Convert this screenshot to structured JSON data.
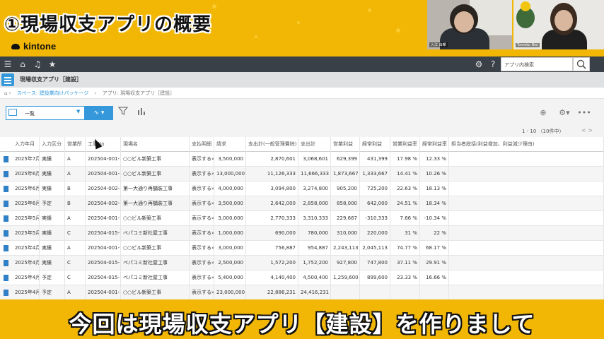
{
  "banner": {
    "title": "①現場収支アプリの概要",
    "logo": "kintone"
  },
  "video": {
    "participant1": "入江 由暉",
    "participant2": "Tomoko Nisi",
    "subtitle": "今回は現場収支アプリ【建設】を作りまして"
  },
  "header": {
    "icons": [
      "menu-icon",
      "home-icon",
      "bell-icon",
      "star-icon",
      "gear-icon",
      "help-icon"
    ],
    "search_placeholder": "アプリ内検索"
  },
  "app": {
    "name": "現場収支アプリ［建設］",
    "breadcrumb": [
      "スペース: 建設業向けパッケージ",
      "アプリ: 現場収支アプリ［建設］"
    ]
  },
  "toolbar": {
    "view_name": "一覧",
    "record_count": "1 - 10 （10件中）",
    "pager": "<   >"
  },
  "table": {
    "columns": [
      "入力年月",
      "入力区分",
      "営業所",
      "工事No",
      "現場名",
      "支払明細",
      "請求",
      "支出計(一般管理費除)",
      "支出計",
      "営業利益",
      "経常利益",
      "営業利益率",
      "経常利益率",
      "担当者総括(利益増加、利益減少理由)"
    ],
    "rows": [
      [
        "2025年7月",
        "実績",
        "A",
        "202504-001-1",
        "○○ビル新築工事",
        "表示する»",
        "3,500,000",
        "2,870,601",
        "3,068,601",
        "629,399",
        "431,399",
        "17.98 %",
        "12.33 %",
        ""
      ],
      [
        "2025年6月",
        "実績",
        "A",
        "202504-001-1",
        "○○ビル新築工事",
        "表示する»",
        "13,000,000",
        "11,126,333",
        "11,666,333",
        "1,873,667",
        "1,333,667",
        "14.41 %",
        "10.26 %",
        ""
      ],
      [
        "2025年6月",
        "実績",
        "B",
        "202504-002-1",
        "第一大通り再舗装工事",
        "表示する»",
        "4,000,000",
        "3,094,800",
        "3,274,800",
        "905,200",
        "725,200",
        "22.63 %",
        "18.13 %",
        ""
      ],
      [
        "2025年6月",
        "予定",
        "B",
        "202504-002-1",
        "第一大通り再舗装工事",
        "表示する»",
        "3,500,000",
        "2,642,000",
        "2,858,000",
        "858,000",
        "642,000",
        "24.51 %",
        "18.34 %",
        ""
      ],
      [
        "2025年5月",
        "実績",
        "A",
        "202504-001-1",
        "○○ビル新築工事",
        "表示する»",
        "3,000,000",
        "2,770,333",
        "3,310,333",
        "229,667",
        "-310,333",
        "7.66 %",
        "-10.34 %",
        ""
      ],
      [
        "2025年5月",
        "実績",
        "C",
        "202504-015-1",
        "ペパコミ新社屋工事",
        "表示する»",
        "1,000,000",
        "690,000",
        "780,000",
        "310,000",
        "220,000",
        "31 %",
        "22 %",
        ""
      ],
      [
        "2025年4月",
        "実績",
        "A",
        "202504-001-1",
        "○○ビル新築工事",
        "表示する»",
        "3,000,000",
        "756,887",
        "954,887",
        "2,243,113",
        "2,045,113",
        "74.77 %",
        "68.17 %",
        ""
      ],
      [
        "2025年4月",
        "実績",
        "C",
        "202504-015-1",
        "ペパコミ新社屋工事",
        "表示する»",
        "2,500,000",
        "1,572,200",
        "1,752,200",
        "927,800",
        "747,800",
        "37.11 %",
        "29.91 %",
        ""
      ],
      [
        "2025年4月",
        "予定",
        "C",
        "202504-015-1",
        "ペパコミ新社屋工事",
        "表示する»",
        "5,400,000",
        "4,140,400",
        "4,500,400",
        "1,259,600",
        "899,600",
        "23.33 %",
        "16.66 %",
        ""
      ],
      [
        "2025年4月",
        "予定",
        "A",
        "202504-001-1",
        "○○ビル新築工事",
        "表示する»",
        "23,000,000",
        "22,886,231",
        "24,416,231",
        "",
        "",
        "",
        "",
        ""
      ]
    ]
  },
  "colors": {
    "banner": "#f2b705",
    "accent": "#3498db",
    "header": "#3a4047"
  }
}
